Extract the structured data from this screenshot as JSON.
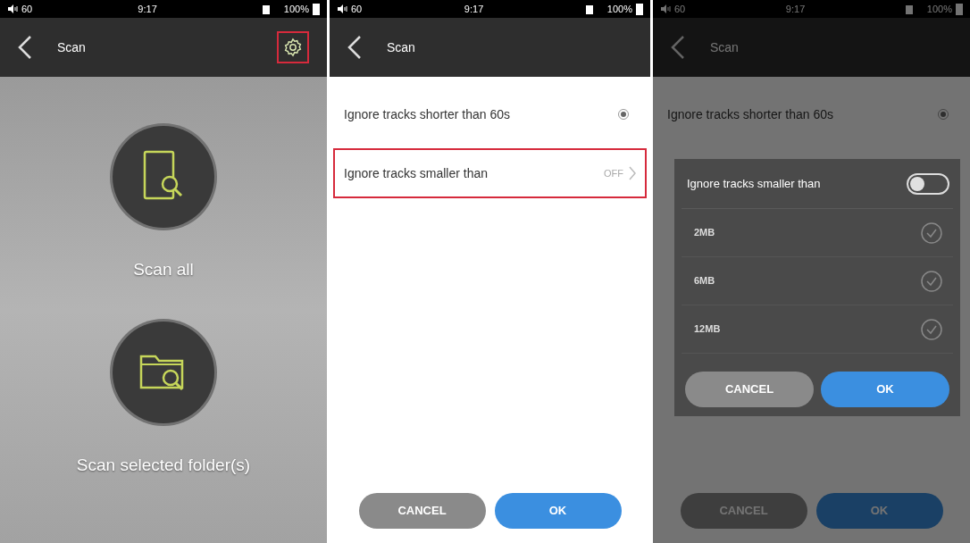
{
  "screens": [
    {
      "kind": "scan_home",
      "status": {
        "volume": "60",
        "time": "9:17",
        "battery": "100%"
      },
      "title": "Scan",
      "settings_highlighted": true,
      "actions": [
        {
          "label": "Scan all",
          "kind": "device"
        },
        {
          "label": "Scan selected folder(s)",
          "kind": "folder"
        }
      ]
    },
    {
      "kind": "settings",
      "dimmed": false,
      "status": {
        "volume": "60",
        "time": "9:17",
        "battery": "100%"
      },
      "title": "Scan",
      "rows": [
        {
          "label": "Ignore tracks shorter than 60s",
          "kind": "radio",
          "checked": true,
          "highlighted": false
        },
        {
          "label": "Ignore tracks smaller than",
          "kind": "link",
          "value": "OFF",
          "highlighted": true
        }
      ],
      "buttons": [
        {
          "label": "CANCEL",
          "kind": "cancel"
        },
        {
          "label": "OK",
          "kind": "ok"
        }
      ]
    },
    {
      "kind": "settings",
      "dimmed": true,
      "status": {
        "volume": "60",
        "time": "9:17",
        "battery": "100%"
      },
      "title": "Scan",
      "rows": [
        {
          "label": "Ignore tracks shorter than 60s",
          "kind": "radio",
          "checked": true,
          "highlighted": false
        }
      ],
      "buttons": [
        {
          "label": "CANCEL",
          "kind": "cancel"
        },
        {
          "label": "OK",
          "kind": "ok"
        }
      ],
      "dialog": {
        "title": "Ignore tracks smaller than",
        "on": false,
        "options": [
          {
            "label": "2MB",
            "selected": false
          },
          {
            "label": "6MB",
            "selected": false
          },
          {
            "label": "12MB",
            "selected": false
          }
        ],
        "buttons": [
          {
            "label": "CANCEL",
            "kind": "cancel"
          },
          {
            "label": "OK",
            "kind": "ok"
          }
        ]
      }
    }
  ]
}
